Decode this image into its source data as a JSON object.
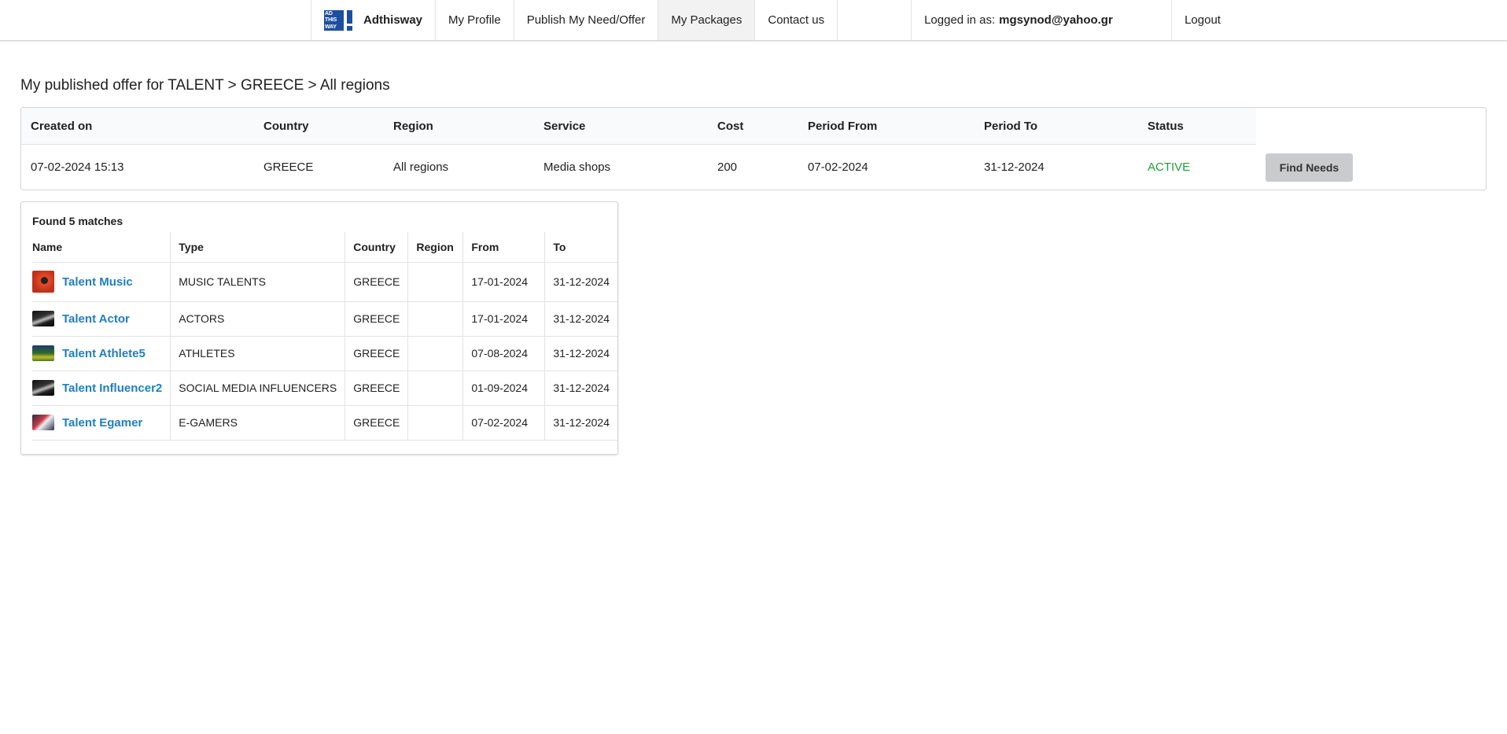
{
  "nav": {
    "brand": "Adthisway",
    "logo_text": "AD THIS WAY",
    "items": [
      {
        "label": "My Profile"
      },
      {
        "label": "Publish My Need/Offer"
      },
      {
        "label": "My Packages"
      },
      {
        "label": "Contact us"
      }
    ],
    "logged_in_label": "Logged in as:",
    "user_email": "mgsynod@yahoo.gr",
    "logout": "Logout"
  },
  "page_title": "My published offer for TALENT > GREECE > All regions",
  "offer": {
    "columns": [
      "Created on",
      "Country",
      "Region",
      "Service",
      "Cost",
      "Period From",
      "Period To",
      "Status"
    ],
    "row": {
      "created_on": "07-02-2024 15:13",
      "country": "GREECE",
      "region": "All regions",
      "service": "Media shops",
      "cost": "200",
      "period_from": "07-02-2024",
      "period_to": "31-12-2024",
      "status": "ACTIVE"
    },
    "find_button": "Find Needs",
    "status_color": "#21a038"
  },
  "matches": {
    "found_label": "Found 5 matches",
    "columns": [
      "Name",
      "Type",
      "Country",
      "Region",
      "From",
      "To"
    ],
    "rows": [
      {
        "name": "Talent Music",
        "type": "MUSIC TALENTS",
        "country": "GREECE",
        "region": "",
        "from": "17-01-2024",
        "to": "31-12-2024",
        "thumb": "music-thumbnail"
      },
      {
        "name": "Talent Actor",
        "type": "ACTORS",
        "country": "GREECE",
        "region": "",
        "from": "17-01-2024",
        "to": "31-12-2024",
        "thumb": "actor-thumbnail"
      },
      {
        "name": "Talent Athlete5",
        "type": "ATHLETES",
        "country": "GREECE",
        "region": "",
        "from": "07-08-2024",
        "to": "31-12-2024",
        "thumb": "athlete-thumbnail"
      },
      {
        "name": "Talent Influencer2",
        "type": "SOCIAL MEDIA INFLUENCERS",
        "country": "GREECE",
        "region": "",
        "from": "01-09-2024",
        "to": "31-12-2024",
        "thumb": "influencer-thumbnail"
      },
      {
        "name": "Talent Egamer",
        "type": "E-GAMERS",
        "country": "GREECE",
        "region": "",
        "from": "07-02-2024",
        "to": "31-12-2024",
        "thumb": "egamer-thumbnail"
      }
    ],
    "link_color": "#1f7fc0"
  },
  "colors": {
    "brand": "#1c4fa0",
    "active_menu_bg": "#f2f2f2"
  }
}
